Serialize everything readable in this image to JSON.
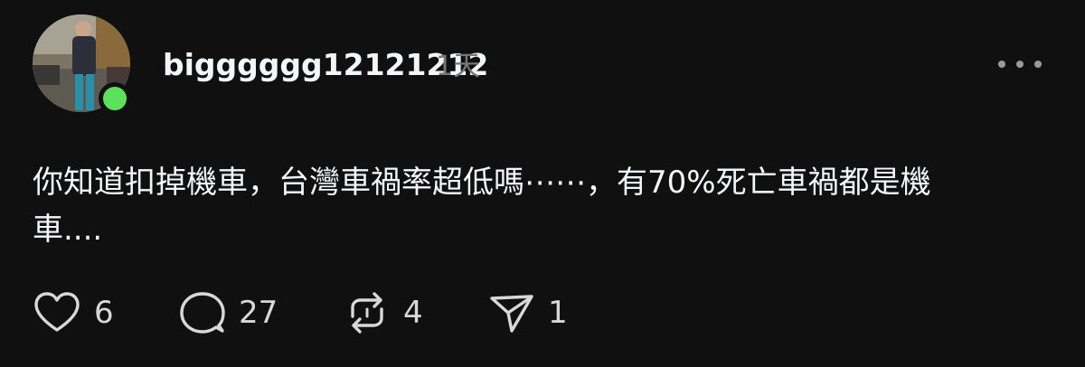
{
  "post": {
    "username": "bigggggg12121212",
    "time_ago": "1天",
    "text": "你知道扣掉機車，台灣車禍率超低嗎⋯⋯，有70%死亡車禍都是機\n車....",
    "online_status_color": "#5ee15a"
  },
  "actions": {
    "like_count": "6",
    "comment_count": "27",
    "repost_count": "4",
    "share_count": "1"
  },
  "icons": {
    "like": "heart-icon",
    "comment": "comment-bubble-icon",
    "repost": "repost-icon",
    "share": "send-icon",
    "more": "more-horizontal-icon"
  }
}
